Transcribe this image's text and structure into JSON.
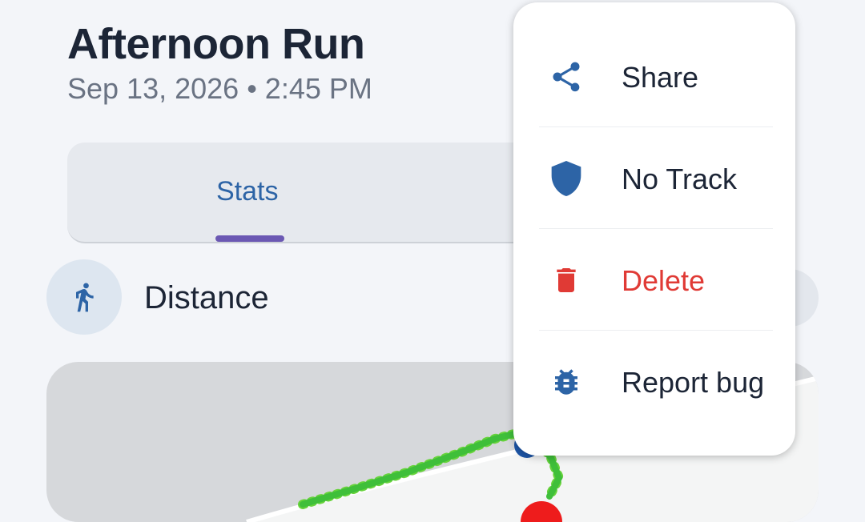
{
  "activity": {
    "title": "Afternoon Run",
    "subtitle": "Sep 13, 2026 • 2:45 PM"
  },
  "tabs": [
    {
      "label": "Stats",
      "selected": true
    }
  ],
  "metric": {
    "icon": "running-icon",
    "label": "Distance"
  },
  "menu": {
    "items": [
      {
        "label": "Share",
        "icon": "share-icon",
        "color": "#1c2536"
      },
      {
        "label": "No Track",
        "icon": "shield-icon",
        "color": "#1c2536"
      },
      {
        "label": "Delete",
        "icon": "trash-icon",
        "color": "#e03a35"
      },
      {
        "label": "Report bug",
        "icon": "bug-icon",
        "color": "#1c2536"
      }
    ]
  },
  "colors": {
    "accent": "#2d64a6",
    "tab_indicator": "#6b58b3",
    "danger": "#e03a35",
    "background": "#f3f5f9"
  }
}
